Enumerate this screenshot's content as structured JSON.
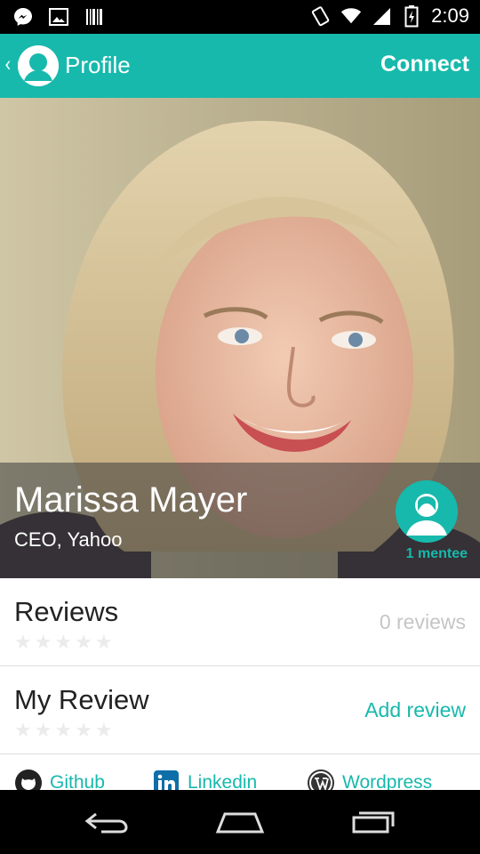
{
  "status_bar": {
    "time": "2:09"
  },
  "app_bar": {
    "back": "‹",
    "title": "Profile",
    "connect": "Connect"
  },
  "profile": {
    "name": "Marissa Mayer",
    "position": "CEO, Yahoo",
    "mentees": "1 mentee"
  },
  "reviews": {
    "label": "Reviews",
    "count": "0 reviews",
    "rating": 0,
    "max": 5
  },
  "my_review": {
    "label": "My Review",
    "action": "Add review",
    "rating": 0,
    "max": 5
  },
  "links": [
    {
      "name": "Github"
    },
    {
      "name": "Linkedin"
    },
    {
      "name": "Wordpress"
    }
  ],
  "colors": {
    "accent": "#17b9ac",
    "muted_text": "#c5c5c5",
    "status_bar": "#000000"
  },
  "icons": {
    "status_left": [
      "messenger-icon",
      "image-icon",
      "barcode-icon"
    ],
    "status_right": [
      "vibrate-icon",
      "wifi-icon",
      "signal-icon",
      "battery-icon"
    ]
  }
}
